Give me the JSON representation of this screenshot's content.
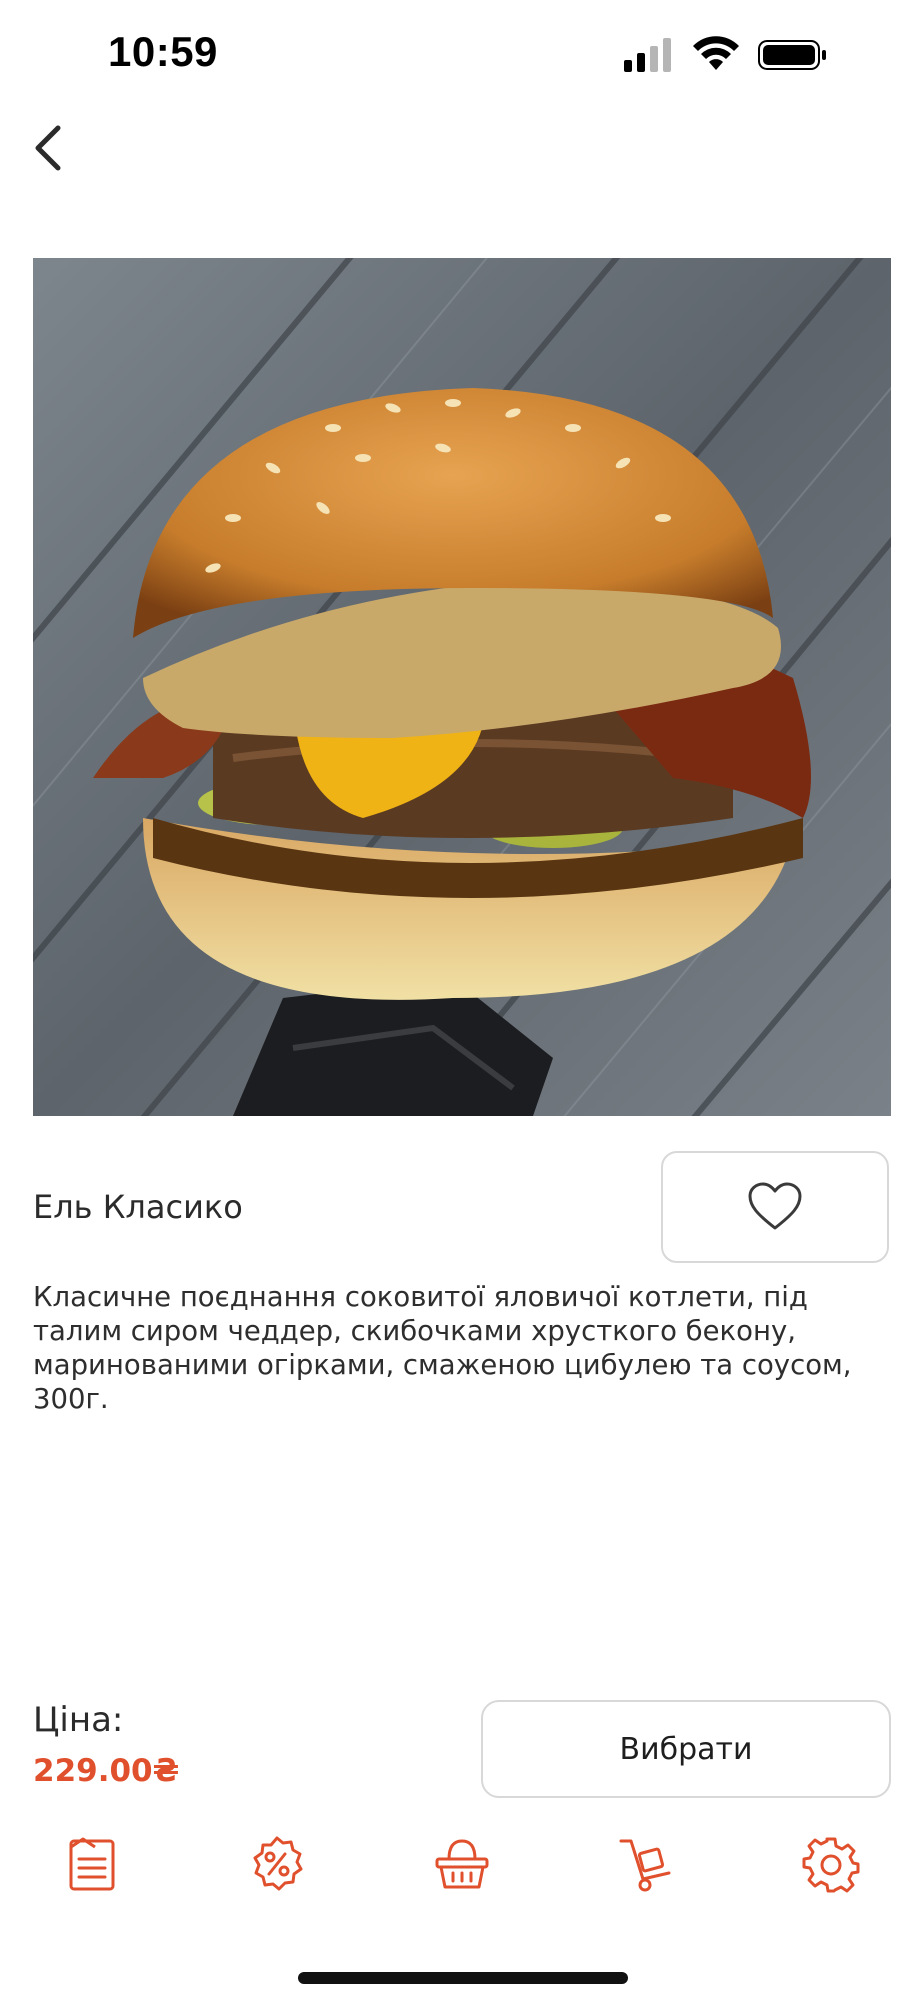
{
  "status_bar": {
    "time": "10:59"
  },
  "header": {
    "back_icon": "chevron-left-icon"
  },
  "product": {
    "image_subject": "burger-photo",
    "title": "Ель Класико",
    "description": "Класичне поєднання соковитої яловичої котлети, під талим сиром чеддер, скибочками хрусткого бекону, маринованими огірками, смаженою цибулею та соусом, 300г.",
    "favorite_icon": "heart-outline-icon"
  },
  "price": {
    "label": "Ціна:",
    "value": "229.00₴"
  },
  "actions": {
    "select_label": "Вибрати"
  },
  "bottom_nav": {
    "items": [
      {
        "name": "menu",
        "icon": "menu-list-icon"
      },
      {
        "name": "promotions",
        "icon": "discount-icon"
      },
      {
        "name": "basket",
        "icon": "basket-icon"
      },
      {
        "name": "delivery",
        "icon": "cart-dolly-icon"
      },
      {
        "name": "settings",
        "icon": "gear-icon"
      }
    ]
  },
  "colors": {
    "accent": "#e0502c",
    "text": "#2b2b2b",
    "border": "#d8d8d8"
  }
}
